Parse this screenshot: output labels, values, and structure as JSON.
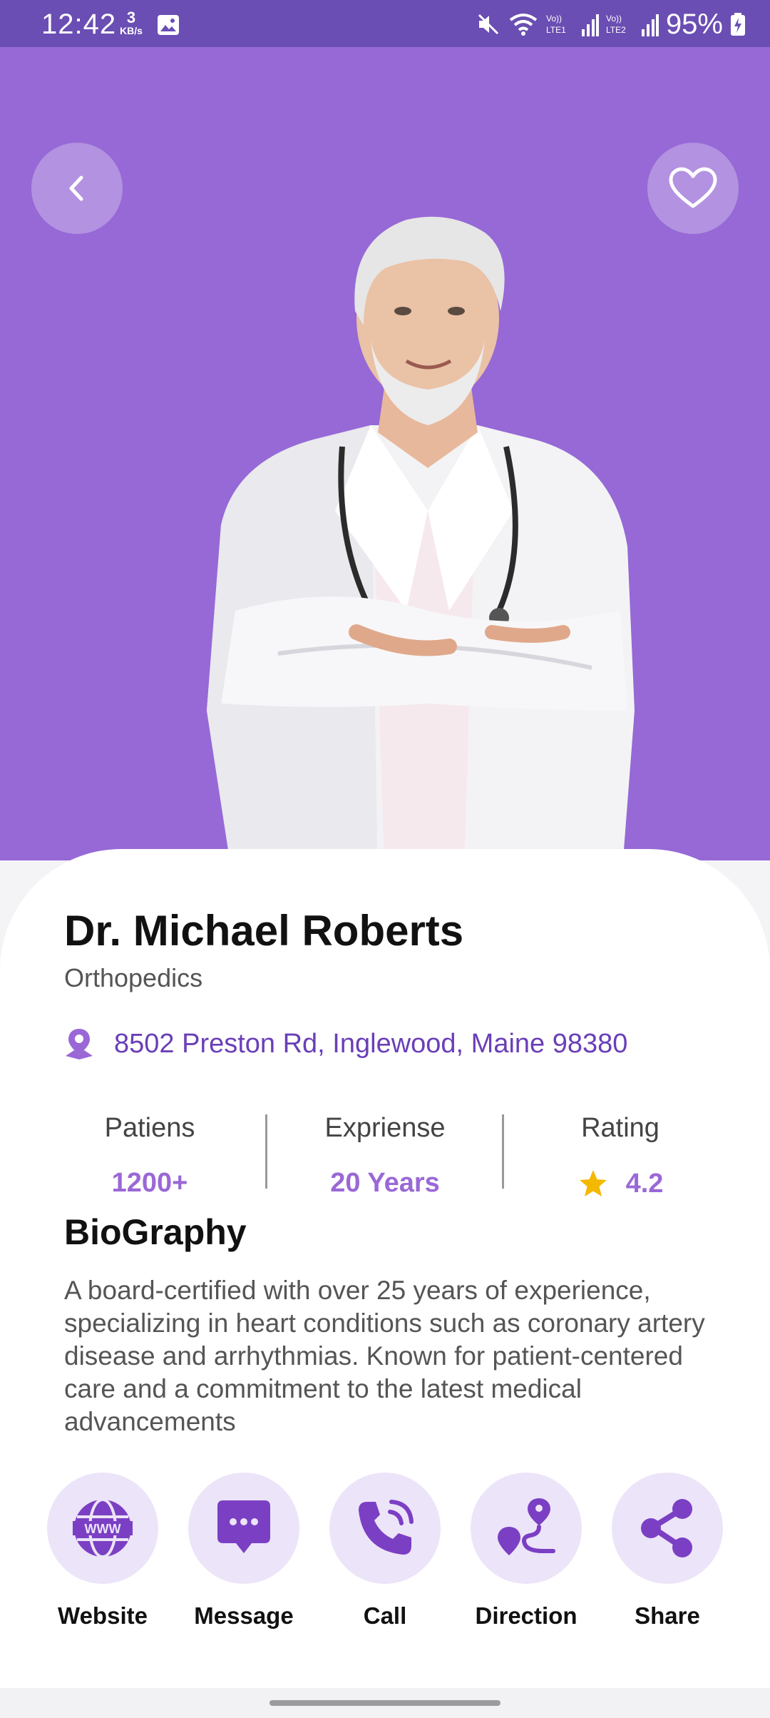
{
  "status_bar": {
    "time": "12:42",
    "data_speed_value": "3",
    "data_speed_unit": "KB/s",
    "network_1": "Vo)) LTE1",
    "network_2": "Vo)) LTE2",
    "battery": "95%"
  },
  "header": {
    "back_icon": "chevron-left-icon",
    "favorite_icon": "heart-outline-icon"
  },
  "doctor": {
    "name": "Dr. Michael Roberts",
    "specialty": "Orthopedics",
    "address": "8502 Preston Rd, Inglewood, Maine 98380"
  },
  "stats": {
    "patients": {
      "label": "Patiens",
      "value": "1200+"
    },
    "experience": {
      "label": "Expriense",
      "value": "20 Years"
    },
    "rating": {
      "label": "Rating",
      "value": "4.2"
    }
  },
  "biography": {
    "title": "BioGraphy",
    "text": "A board-certified with over 25 years of experience, specializing in heart conditions such as coronary artery  disease and arrhythmias. Known for patient-centered care  and a commitment to the latest medical advancements"
  },
  "actions": [
    {
      "label": "Website",
      "icon": "www-globe-icon"
    },
    {
      "label": "Message",
      "icon": "chat-bubble-icon"
    },
    {
      "label": "Call",
      "icon": "phone-call-icon"
    },
    {
      "label": "Direction",
      "icon": "route-pin-icon"
    },
    {
      "label": "Share",
      "icon": "share-icon"
    }
  ],
  "colors": {
    "hero_background": "#9669d6",
    "status_bar": "#6a4eb3",
    "accent": "#7b3fc4",
    "accent_light": "#ece4f8",
    "star": "#f5b800"
  }
}
